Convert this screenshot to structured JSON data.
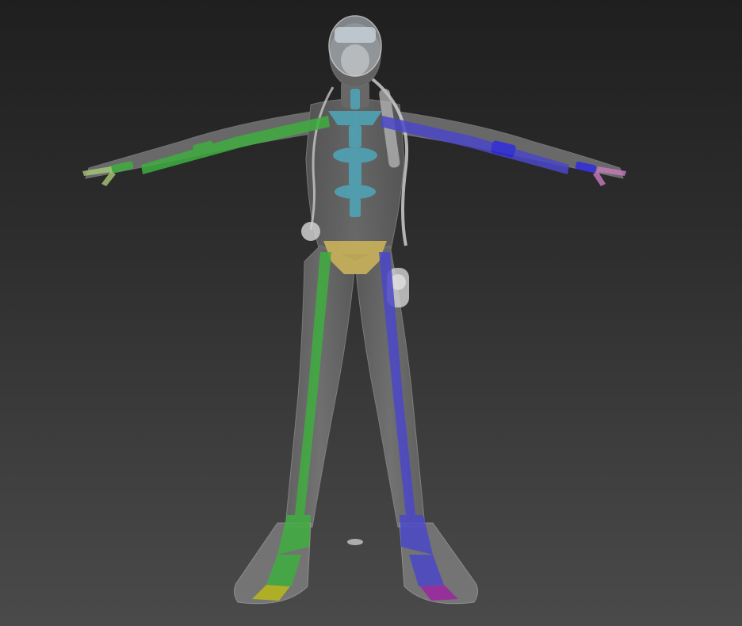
{
  "viewport": {
    "kind": "3d-viewport",
    "background_top": "#1f1f1f",
    "background_bottom": "#4a4a4a"
  },
  "scene": {
    "subject": "scuba-diver-model",
    "mesh_display": "see-through",
    "bones": {
      "spine_color": "#4fa3b5",
      "pelvis_color": "#c9b35a",
      "left_side_color": "#3fae3f",
      "right_side_color": "#4b48c8",
      "left_toe_color": "#b5b51f",
      "right_toe_color": "#9a2aa0"
    },
    "objects": [
      "diving-mask",
      "regulator-hose",
      "air-tank-valve",
      "fins"
    ]
  }
}
